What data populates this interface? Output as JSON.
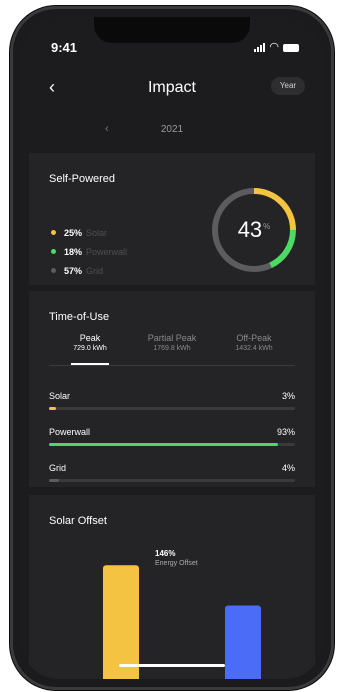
{
  "status": {
    "time": "9:41"
  },
  "header": {
    "title": "Impact",
    "year_button": "Year",
    "year": "2021"
  },
  "self_powered": {
    "title": "Self-Powered",
    "percent": "43",
    "unit": "%",
    "sources": [
      {
        "pct": "25%",
        "name": "Solar",
        "color": "#f5c342",
        "value": 25
      },
      {
        "pct": "18%",
        "name": "Powerwall",
        "color": "#4cd964",
        "value": 18
      },
      {
        "pct": "57%",
        "name": "Grid",
        "color": "#5c5c5e",
        "value": 57
      }
    ]
  },
  "time_of_use": {
    "title": "Time-of-Use",
    "tabs": [
      {
        "name": "Peak",
        "value": "729.0 kWh",
        "active": true
      },
      {
        "name": "Partial Peak",
        "value": "1769.8 kWh",
        "active": false
      },
      {
        "name": "Off-Peak",
        "value": "1432.4 kWh",
        "active": false
      }
    ],
    "bars": [
      {
        "label": "Solar",
        "pct": "3%",
        "value": 3,
        "color": "#f5c342"
      },
      {
        "label": "Powerwall",
        "pct": "93%",
        "value": 93,
        "color": "#4cd964"
      },
      {
        "label": "Grid",
        "pct": "4%",
        "value": 4,
        "color": "#5c5c5e"
      }
    ]
  },
  "solar_offset": {
    "title": "Solar Offset",
    "percent": "146%",
    "label": "Energy Offset",
    "chart_data": {
      "type": "bar",
      "categories": [
        "",
        ""
      ],
      "values": [
        146,
        100
      ],
      "colors": [
        "#f5c342",
        "#4a6cf7"
      ],
      "ylim": [
        0,
        160
      ]
    }
  }
}
